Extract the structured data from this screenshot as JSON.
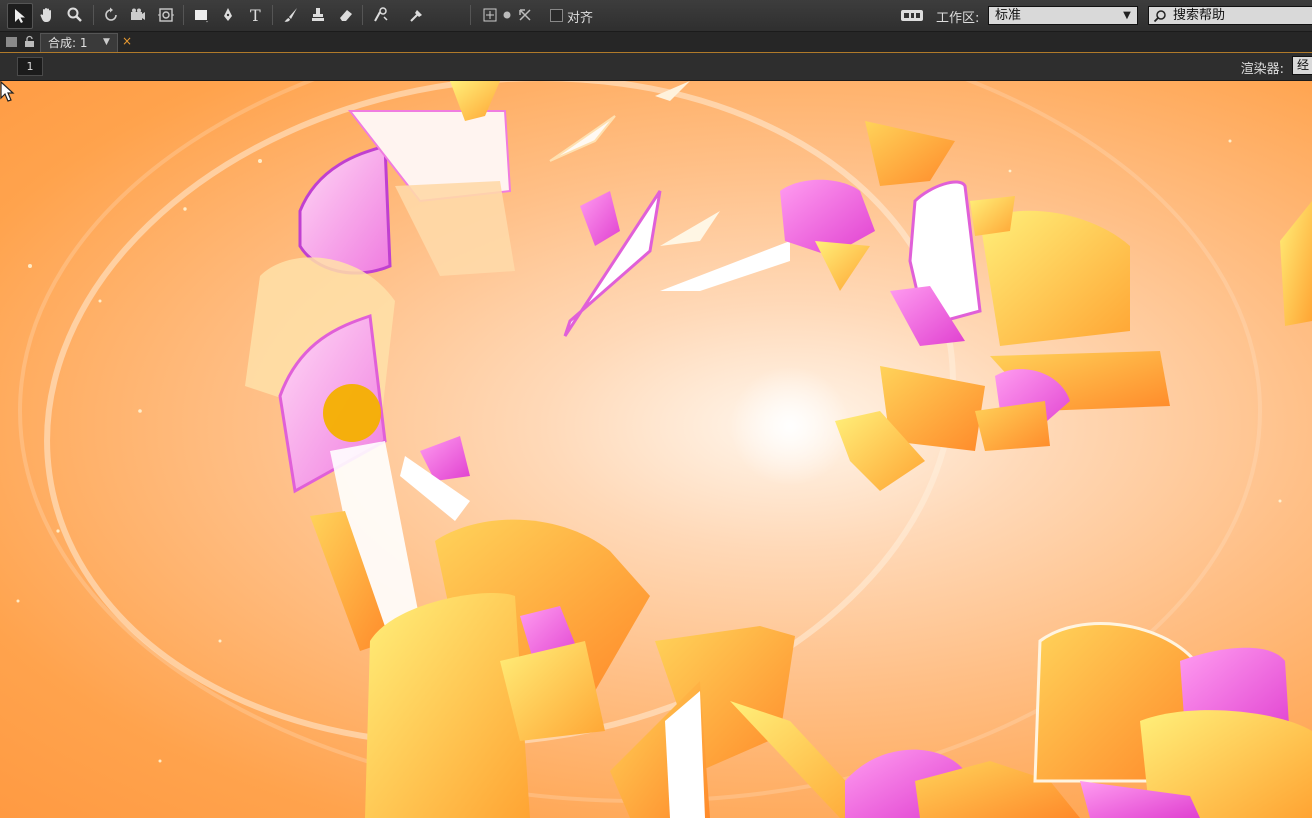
{
  "toolbar": {
    "tools": [
      "selection-tool",
      "hand-tool",
      "zoom-tool",
      "rotation-tool",
      "camera-orbit-tool",
      "pan-behind-tool",
      "rectangle-tool",
      "pen-tool",
      "type-tool",
      "brush-tool",
      "clone-stamp-tool",
      "eraser-tool",
      "roto-brush-tool",
      "puppet-pin-tool"
    ],
    "snap_label": "对齐",
    "workspace_label": "工作区:",
    "workspace_value": "标准",
    "search_placeholder": "搜索帮助"
  },
  "tabbar": {
    "tab_label": "合成: 1"
  },
  "comp_header": {
    "comp_number": "1",
    "renderer_label": "渲染器:",
    "renderer_value": "经"
  },
  "viewer": {
    "background_colors": [
      "#fff6ec",
      "#ffd9b8",
      "#ffbf86",
      "#ffa34d"
    ],
    "accent": "#f4b000"
  }
}
